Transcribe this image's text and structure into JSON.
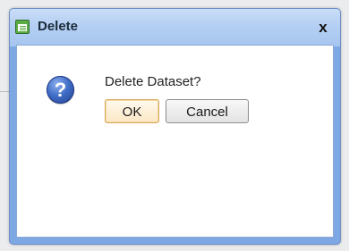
{
  "dialog": {
    "title": "Delete",
    "close_label": "x",
    "message": "Delete Dataset?",
    "question_glyph": "?",
    "ok_label": "OK",
    "cancel_label": "Cancel"
  },
  "icons": {
    "title_icon": "dataset-form-icon",
    "message_icon": "question-icon",
    "close_icon": "close-icon"
  },
  "colors": {
    "titlebar": "#b4cff2",
    "frame": "#7ea8e3",
    "content": "#ffffff",
    "ok_border": "#d8a95a",
    "question_icon": "#3f6dc6"
  }
}
